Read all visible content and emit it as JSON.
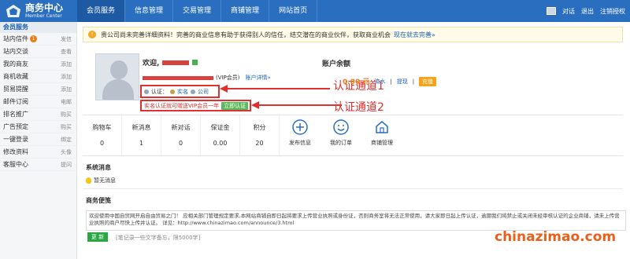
{
  "header": {
    "logo_title": "商务中心",
    "logo_sub": "Member Center",
    "nav": [
      "会员服务",
      "信息管理",
      "交易管理",
      "商铺管理",
      "网站首页"
    ],
    "right": [
      "对话",
      "退出",
      "注销授权"
    ]
  },
  "sidebar": {
    "title": "会员服务",
    "items": [
      {
        "label": "站内信件",
        "right": "发信",
        "badge": "1"
      },
      {
        "label": "站内交谈",
        "right": "查看"
      },
      {
        "label": "我的商友",
        "right": "添加"
      },
      {
        "label": "商机收藏",
        "right": "添加"
      },
      {
        "label": "贸易提醒",
        "right": "添加"
      },
      {
        "label": "邮件订阅",
        "right": "电邮"
      },
      {
        "label": "排名推广",
        "right": "购买"
      },
      {
        "label": "广告预定",
        "right": "购买"
      },
      {
        "label": "一键登录",
        "right": "绑定"
      },
      {
        "label": "修改资料",
        "right": "头像"
      },
      {
        "label": "客服中心",
        "right": "提问"
      }
    ]
  },
  "notice": {
    "text": "贵公司尚未完善详细资料！完善的商业信息有助于获得别人的信任，结交潜在的商业伙伴，获取商业机会",
    "link": "现在就去完善»"
  },
  "profile": {
    "welcome": "欢迎,",
    "vip_suffix": "(VIP会员)",
    "account_link": "账户详情»",
    "auth_label": "认证：",
    "auth_items": [
      "实名",
      "公司"
    ],
    "vip_text": "实名认证就可赠送VIP会员一年",
    "vip_button": "立即认证"
  },
  "balance": {
    "title": "账户余额",
    "amount": "0.00 元",
    "links": [
      "流水",
      "提现"
    ],
    "button": "充值"
  },
  "callouts": [
    "认证通道1",
    "认证通道2"
  ],
  "stats": [
    {
      "label": "购物车",
      "value": "0"
    },
    {
      "label": "新消息",
      "value": "1"
    },
    {
      "label": "新对话",
      "value": "0"
    },
    {
      "label": "保证金",
      "value": "0.00"
    },
    {
      "label": "积分",
      "value": "20"
    }
  ],
  "features": [
    "发布信息",
    "我的订单",
    "商铺管理"
  ],
  "system": {
    "title": "系统消息",
    "item": "暂无消息"
  },
  "business": {
    "title": "商务便笺",
    "text": "欢迎使用中国自贸网开启自由贸易之门！ 应相关部门管理规定要求,本网站商铺自即日起将要求上传营业执照或身份证，否则商务室将无法正常使用，请大家即日起上传认证，逾期我们将禁止或关闭未经审核认证的企业商铺，请未上传营业执照的商户尽快上传并认证。 详见：http://www.chinazimao.com/announce/3.html",
    "button": "更 新",
    "hint": "[笔记录一些文字备忘，限5000字]"
  },
  "watermark": "chinazimao.com"
}
